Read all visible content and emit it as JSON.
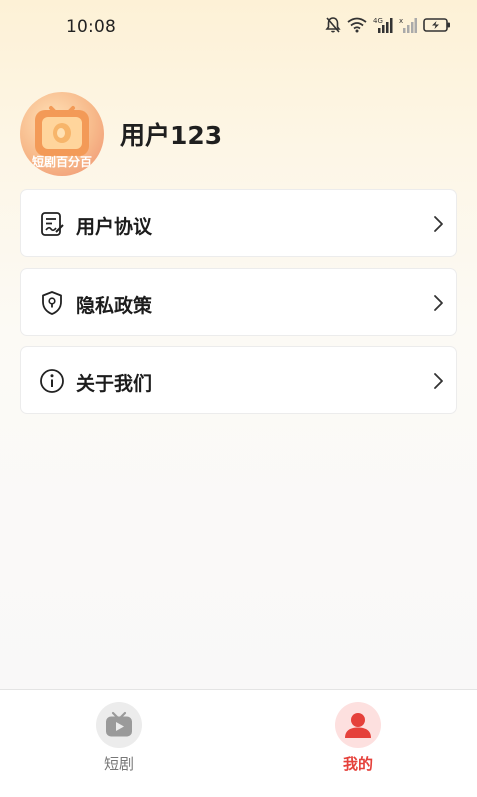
{
  "status_bar": {
    "time": "10:08",
    "icons": [
      "mute-bell-icon",
      "wifi-icon",
      "signal-4g-icon",
      "signal-no-service-icon",
      "battery-charging-icon"
    ]
  },
  "profile": {
    "username": "用户123",
    "avatar_caption": "短剧百分百"
  },
  "menu": [
    {
      "label": "用户协议",
      "icon": "document-sign-icon"
    },
    {
      "label": "隐私政策",
      "icon": "shield-keyhole-icon"
    },
    {
      "label": "关于我们",
      "icon": "info-circle-icon"
    }
  ],
  "tab_bar": {
    "tabs": [
      {
        "label": "短剧",
        "icon": "tv-icon",
        "active": false
      },
      {
        "label": "我的",
        "icon": "person-icon",
        "active": true
      }
    ],
    "colors": {
      "active": "#e5413b",
      "inactive": "#777777"
    }
  }
}
